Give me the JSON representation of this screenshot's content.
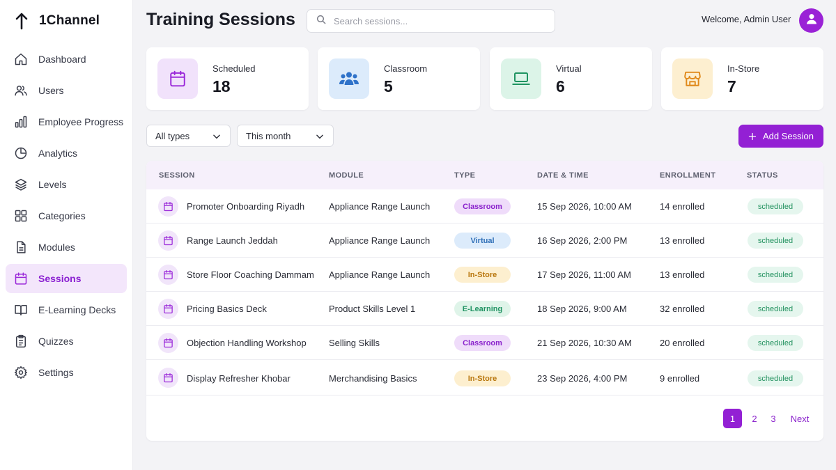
{
  "app": {
    "name": "1Channel"
  },
  "sidebar": {
    "items": [
      {
        "label": "Dashboard",
        "icon": "home-icon"
      },
      {
        "label": "Users",
        "icon": "users-icon"
      },
      {
        "label": "Employee Progress",
        "icon": "bar-chart-icon"
      },
      {
        "label": "Analytics",
        "icon": "pie-chart-icon"
      },
      {
        "label": "Levels",
        "icon": "layers-icon"
      },
      {
        "label": "Categories",
        "icon": "grid-icon"
      },
      {
        "label": "Modules",
        "icon": "document-icon"
      },
      {
        "label": "Sessions",
        "icon": "calendar-icon",
        "active": true
      },
      {
        "label": "E-Learning Decks",
        "icon": "book-icon"
      },
      {
        "label": "Quizzes",
        "icon": "clipboard-icon"
      },
      {
        "label": "Settings",
        "icon": "gear-icon"
      }
    ]
  },
  "header": {
    "title": "Training Sessions",
    "search_placeholder": "Search sessions...",
    "welcome": "Welcome, Admin User"
  },
  "stats": [
    {
      "label": "Scheduled",
      "value": "18",
      "icon": "calendar-icon",
      "color": "#9a28d9",
      "bg": "#f1e2fb"
    },
    {
      "label": "Classroom",
      "value": "5",
      "icon": "users-icon",
      "color": "#2f72c9",
      "bg": "#dcebfb"
    },
    {
      "label": "Virtual",
      "value": "6",
      "icon": "laptop-icon",
      "color": "#1f9461",
      "bg": "#dcf4e8"
    },
    {
      "label": "In-Store",
      "value": "7",
      "icon": "store-icon",
      "color": "#e08a1c",
      "bg": "#fdefd0"
    }
  ],
  "filters": {
    "type": "All types",
    "period": "This month",
    "add_label": "Add Session"
  },
  "table": {
    "headers": [
      "SESSION",
      "MODULE",
      "TYPE",
      "DATE & TIME",
      "ENROLLMENT",
      "STATUS"
    ],
    "rows": [
      {
        "session": "Promoter Onboarding Riyadh",
        "module": "Appliance Range Launch",
        "type": "Classroom",
        "datetime": "15 Sep 2026, 10:00 AM",
        "enrollment": "14 enrolled",
        "status": "scheduled"
      },
      {
        "session": "Range Launch Jeddah",
        "module": "Appliance Range Launch",
        "type": "Virtual",
        "datetime": "16 Sep 2026, 2:00 PM",
        "enrollment": "13 enrolled",
        "status": "scheduled"
      },
      {
        "session": "Store Floor Coaching Dammam",
        "module": "Appliance Range Launch",
        "type": "In-Store",
        "datetime": "17 Sep 2026, 11:00 AM",
        "enrollment": "13 enrolled",
        "status": "scheduled"
      },
      {
        "session": "Pricing Basics Deck",
        "module": "Product Skills Level 1",
        "type": "E-Learning",
        "datetime": "18 Sep 2026, 9:00 AM",
        "enrollment": "32 enrolled",
        "status": "scheduled"
      },
      {
        "session": "Objection Handling Workshop",
        "module": "Selling Skills",
        "type": "Classroom",
        "datetime": "21 Sep 2026, 10:30 AM",
        "enrollment": "20 enrolled",
        "status": "scheduled"
      },
      {
        "session": "Display Refresher Khobar",
        "module": "Merchandising Basics",
        "type": "In-Store",
        "datetime": "23 Sep 2026, 4:00 PM",
        "enrollment": "9 enrolled",
        "status": "scheduled"
      }
    ]
  },
  "pagination": {
    "pages": [
      "1",
      "2",
      "3"
    ],
    "current": "1",
    "next": "Next"
  },
  "colors": {
    "accent": "#9320d4",
    "active_nav_bg": "#f3e6fb"
  }
}
